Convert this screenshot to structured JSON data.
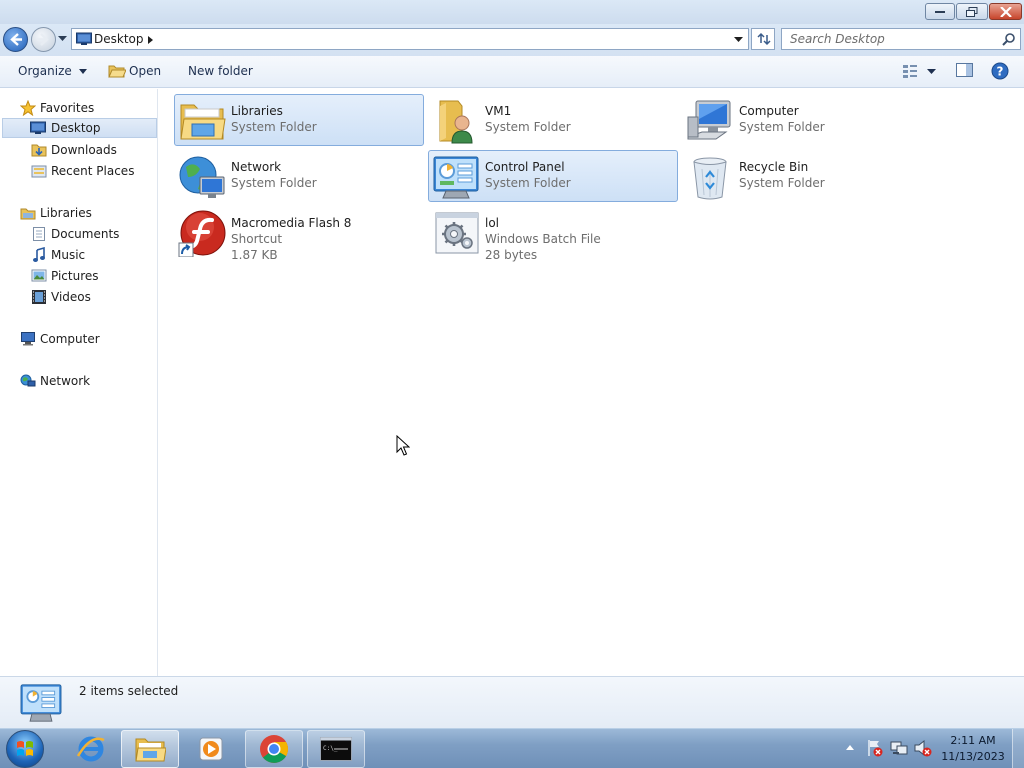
{
  "window": {
    "address_crumb": "Desktop",
    "search_placeholder": "Search Desktop"
  },
  "toolbar": {
    "organize_label": "Organize",
    "open_label": "Open",
    "new_folder_label": "New folder"
  },
  "nav": {
    "favorites": "Favorites",
    "desktop": "Desktop",
    "downloads": "Downloads",
    "recent_places": "Recent Places",
    "libraries": "Libraries",
    "documents": "Documents",
    "music": "Music",
    "pictures": "Pictures",
    "videos": "Videos",
    "computer": "Computer",
    "network": "Network"
  },
  "items": [
    {
      "name": "Libraries",
      "type": "System Folder",
      "icon": "libraries-icon",
      "selected": true
    },
    {
      "name": "VM1",
      "type": "System Folder",
      "icon": "user-folder-icon",
      "selected": false
    },
    {
      "name": "Computer",
      "type": "System Folder",
      "icon": "computer-icon",
      "selected": false
    },
    {
      "name": "Network",
      "type": "System Folder",
      "icon": "network-icon",
      "selected": false
    },
    {
      "name": "Control Panel",
      "type": "System Folder",
      "icon": "control-panel-icon",
      "selected": true
    },
    {
      "name": "Recycle Bin",
      "type": "System Folder",
      "icon": "recycle-bin-icon",
      "selected": false
    },
    {
      "name": "Macromedia Flash 8",
      "type": "Shortcut",
      "size": "1.87 KB",
      "icon": "flash-icon",
      "selected": false
    },
    {
      "name": "lol",
      "type": "Windows Batch File",
      "size": "28 bytes",
      "icon": "batch-file-icon",
      "selected": false
    }
  ],
  "details": {
    "status": "2 items selected"
  },
  "taskbar": {
    "time": "2:11 AM",
    "date": "11/13/2023"
  }
}
